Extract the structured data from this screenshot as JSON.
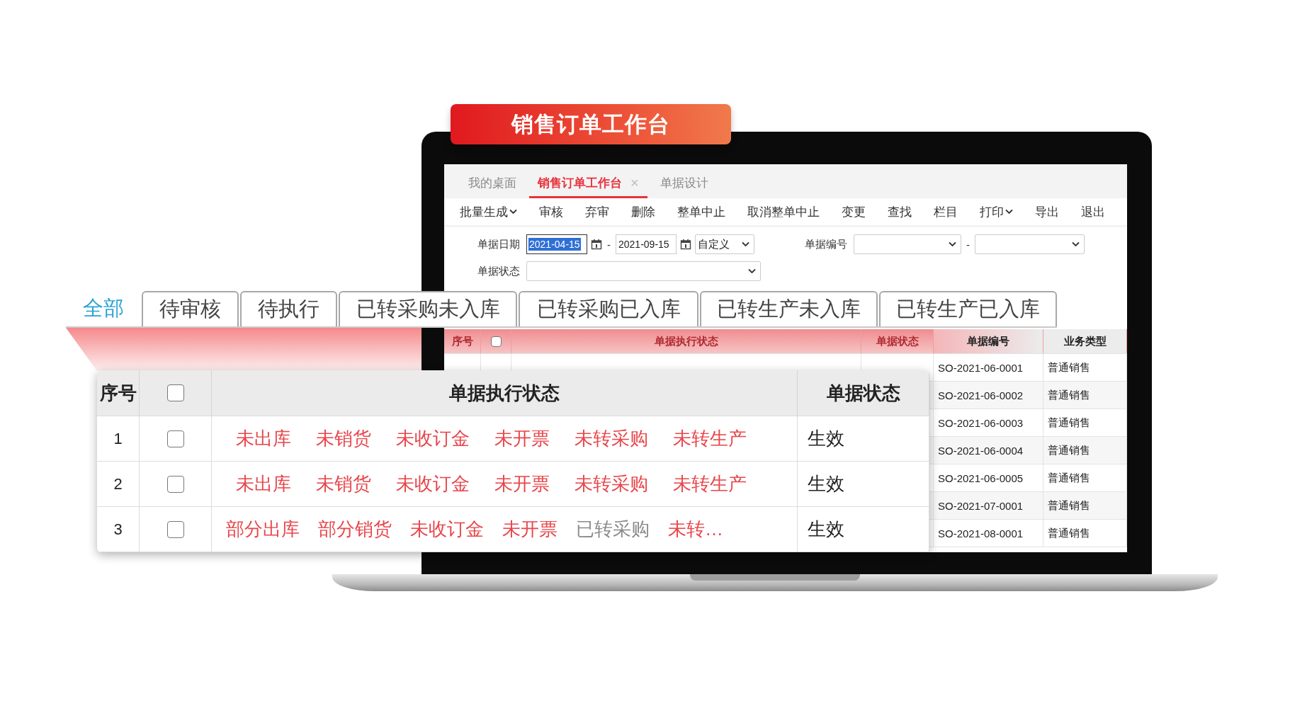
{
  "banner": {
    "title": "销售订单工作台"
  },
  "app": {
    "tabs": [
      {
        "label": "我的桌面",
        "selected": false
      },
      {
        "label": "销售订单工作台",
        "selected": true,
        "close": "×"
      },
      {
        "label": "单据设计",
        "selected": false
      }
    ],
    "toolbar": [
      {
        "label": "批量生成",
        "dropdown": true
      },
      {
        "label": "审核",
        "dropdown": false
      },
      {
        "label": "弃审",
        "dropdown": false
      },
      {
        "label": "删除",
        "dropdown": false
      },
      {
        "label": "整单中止",
        "dropdown": false
      },
      {
        "label": "取消整单中止",
        "dropdown": false
      },
      {
        "label": "变更",
        "dropdown": false
      },
      {
        "label": "查找",
        "dropdown": false
      },
      {
        "label": "栏目",
        "dropdown": false
      },
      {
        "label": "打印",
        "dropdown": true
      },
      {
        "label": "导出",
        "dropdown": false
      },
      {
        "label": "退出",
        "dropdown": false
      }
    ],
    "filters": {
      "date": {
        "label": "单据日期",
        "from": {
          "value": "2021-04-15",
          "highlighted": true
        },
        "separator": "-",
        "to": {
          "value": "2021-09-15",
          "highlighted": false
        },
        "range": "自定义"
      },
      "number": {
        "label": "单据编号",
        "separator": "-"
      },
      "status": {
        "label": "单据状态"
      }
    },
    "table": {
      "columns": [
        {
          "kind": "text",
          "label": "序号"
        },
        {
          "kind": "checkbox",
          "checked": false
        },
        {
          "kind": "text",
          "label": "单据执行状态"
        },
        {
          "kind": "text",
          "label": "单据状态"
        },
        {
          "kind": "text",
          "label": "单据编号"
        },
        {
          "kind": "text",
          "label": "业务类型"
        }
      ],
      "rows": [
        {
          "number": "SO-2021-06-0001",
          "type": "普通销售"
        },
        {
          "number": "SO-2021-06-0002",
          "type": "普通销售"
        },
        {
          "number": "SO-2021-06-0003",
          "type": "普通销售"
        },
        {
          "number": "SO-2021-06-0004",
          "type": "普通销售"
        },
        {
          "number": "SO-2021-06-0005",
          "type": "普通销售"
        },
        {
          "number": "SO-2021-07-0001",
          "type": "普通销售"
        },
        {
          "number": "SO-2021-08-0001",
          "type": "普通销售"
        }
      ]
    }
  },
  "status_tabs": [
    {
      "label": "全部",
      "selected": true
    },
    {
      "label": "待审核",
      "selected": false
    },
    {
      "label": "待执行",
      "selected": false
    },
    {
      "label": "已转采购未入库",
      "selected": false
    },
    {
      "label": "已转采购已入库",
      "selected": false
    },
    {
      "label": "已转生产未入库",
      "selected": false
    },
    {
      "label": "已转生产已入库",
      "selected": false
    }
  ],
  "zoom_table": {
    "columns": [
      {
        "kind": "text",
        "label": "序号"
      },
      {
        "kind": "checkbox",
        "checked": false
      },
      {
        "kind": "text",
        "label": "单据执行状态"
      },
      {
        "kind": "text",
        "label": "单据状态"
      }
    ],
    "rows": [
      {
        "index": "1",
        "checked": false,
        "state": "生效",
        "statuses": [
          {
            "label": "未出库",
            "done": false
          },
          {
            "label": "未销货",
            "done": false
          },
          {
            "label": "未收订金",
            "done": false
          },
          {
            "label": "未开票",
            "done": false
          },
          {
            "label": "未转采购",
            "done": false
          },
          {
            "label": "未转生产",
            "done": false
          }
        ]
      },
      {
        "index": "2",
        "checked": false,
        "state": "生效",
        "statuses": [
          {
            "label": "未出库",
            "done": false
          },
          {
            "label": "未销货",
            "done": false
          },
          {
            "label": "未收订金",
            "done": false
          },
          {
            "label": "未开票",
            "done": false
          },
          {
            "label": "未转采购",
            "done": false
          },
          {
            "label": "未转生产",
            "done": false
          }
        ]
      },
      {
        "index": "3",
        "checked": false,
        "state": "生效",
        "statuses": [
          {
            "label": "部分出库",
            "done": false
          },
          {
            "label": "部分销货",
            "done": false
          },
          {
            "label": "未收订金",
            "done": false
          },
          {
            "label": "未开票",
            "done": false
          },
          {
            "label": "已转采购",
            "done": true
          },
          {
            "label": "未转…",
            "done": false
          }
        ]
      }
    ]
  }
}
